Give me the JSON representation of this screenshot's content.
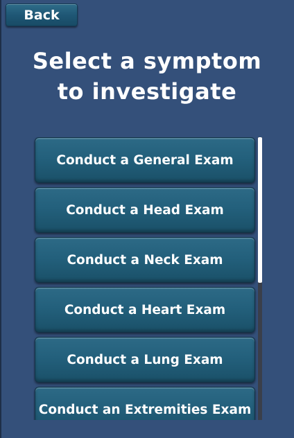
{
  "header": {
    "back_label": "Back",
    "title_line1": "Select a symptom",
    "title_line2": "to investigate"
  },
  "exams": [
    {
      "label": "Conduct a General Exam"
    },
    {
      "label": "Conduct a Head Exam"
    },
    {
      "label": "Conduct a Neck Exam"
    },
    {
      "label": "Conduct a Heart Exam"
    },
    {
      "label": "Conduct a Lung Exam"
    },
    {
      "label": "Conduct an Extremities Exam"
    }
  ],
  "colors": {
    "background": "#34507a",
    "button": "#23607c",
    "text": "#ffffff"
  }
}
